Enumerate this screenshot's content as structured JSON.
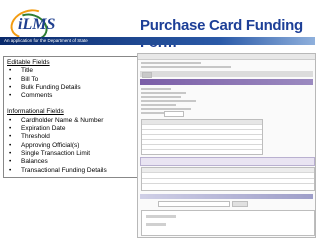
{
  "header": {
    "logo_text": "iLMS",
    "tagline": "An application for the Department of State",
    "title": "Purchase Card Funding Form"
  },
  "panel": {
    "editable_heading": "Editable Fields",
    "editable_fields": [
      "Title",
      "Bill To",
      "Bulk Funding Details",
      "Comments"
    ],
    "informational_heading": "Informational Fields",
    "informational_fields": [
      "Cardholder Name & Number",
      "Expiration Date",
      "Threshold",
      "Approving Official(s)",
      "Single Transaction Limit",
      "Balances",
      "Transactional Funding Details"
    ]
  },
  "colors": {
    "title": "#1d3f97",
    "bar_dark": "#0a2a6b",
    "bar_light": "#8fb0dc",
    "logo_orange": "#f39c12",
    "logo_green": "#2e7d32"
  }
}
